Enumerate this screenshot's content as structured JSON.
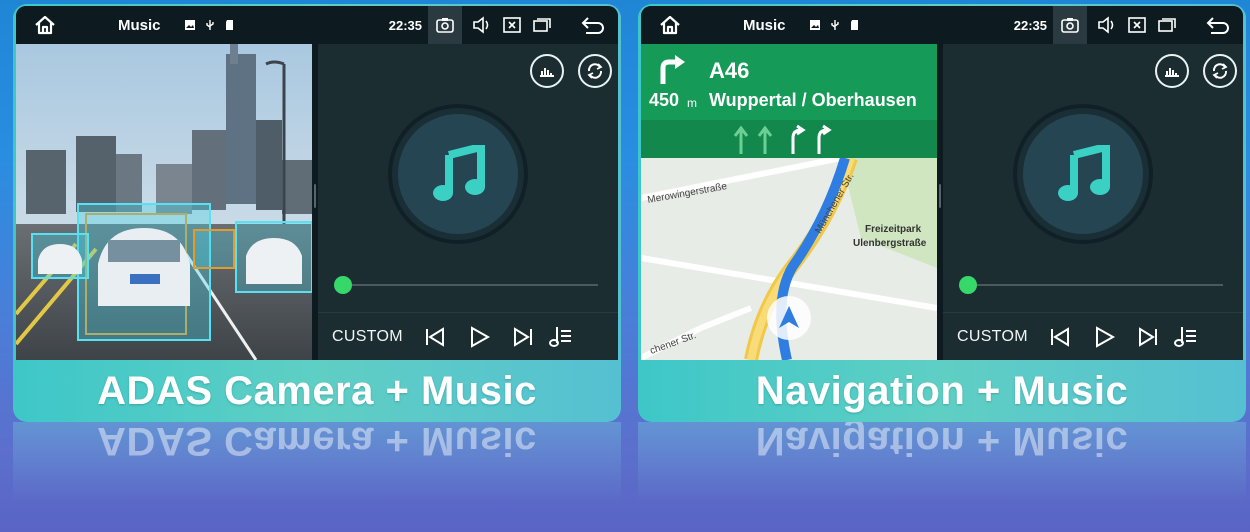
{
  "status_bar": {
    "app_title": "Music",
    "time": "22:35"
  },
  "music_player": {
    "custom_label": "CUSTOM",
    "progress": 0.0
  },
  "left_panel": {
    "caption": "ADAS Camera + Music"
  },
  "right_panel": {
    "caption": "Navigation + Music",
    "navigation": {
      "road": "A46",
      "distance": "450",
      "distance_unit": "m",
      "destination": "Wuppertal / Oberhausen",
      "map_labels": {
        "street_1": "Merowingerstraße",
        "street_2": "Münchener Str.",
        "street_3": "chener Str.",
        "poi_1": "Freizeitpark",
        "poi_2": "Ulenbergstraße"
      }
    }
  },
  "colors": {
    "accent_green": "#36d86a",
    "nav_green": "#169a57",
    "teal_caption": "#3ec7c8",
    "route_blue": "#2f7de1"
  },
  "icons": [
    "home-icon",
    "image-icon",
    "usb-icon",
    "sd-card-icon",
    "camera-icon",
    "volume-icon",
    "close-box-icon",
    "windows-icon",
    "back-icon",
    "equalizer-icon",
    "repeat-icon",
    "music-note-icon",
    "previous-icon",
    "play-icon",
    "next-icon",
    "playlist-icon"
  ]
}
